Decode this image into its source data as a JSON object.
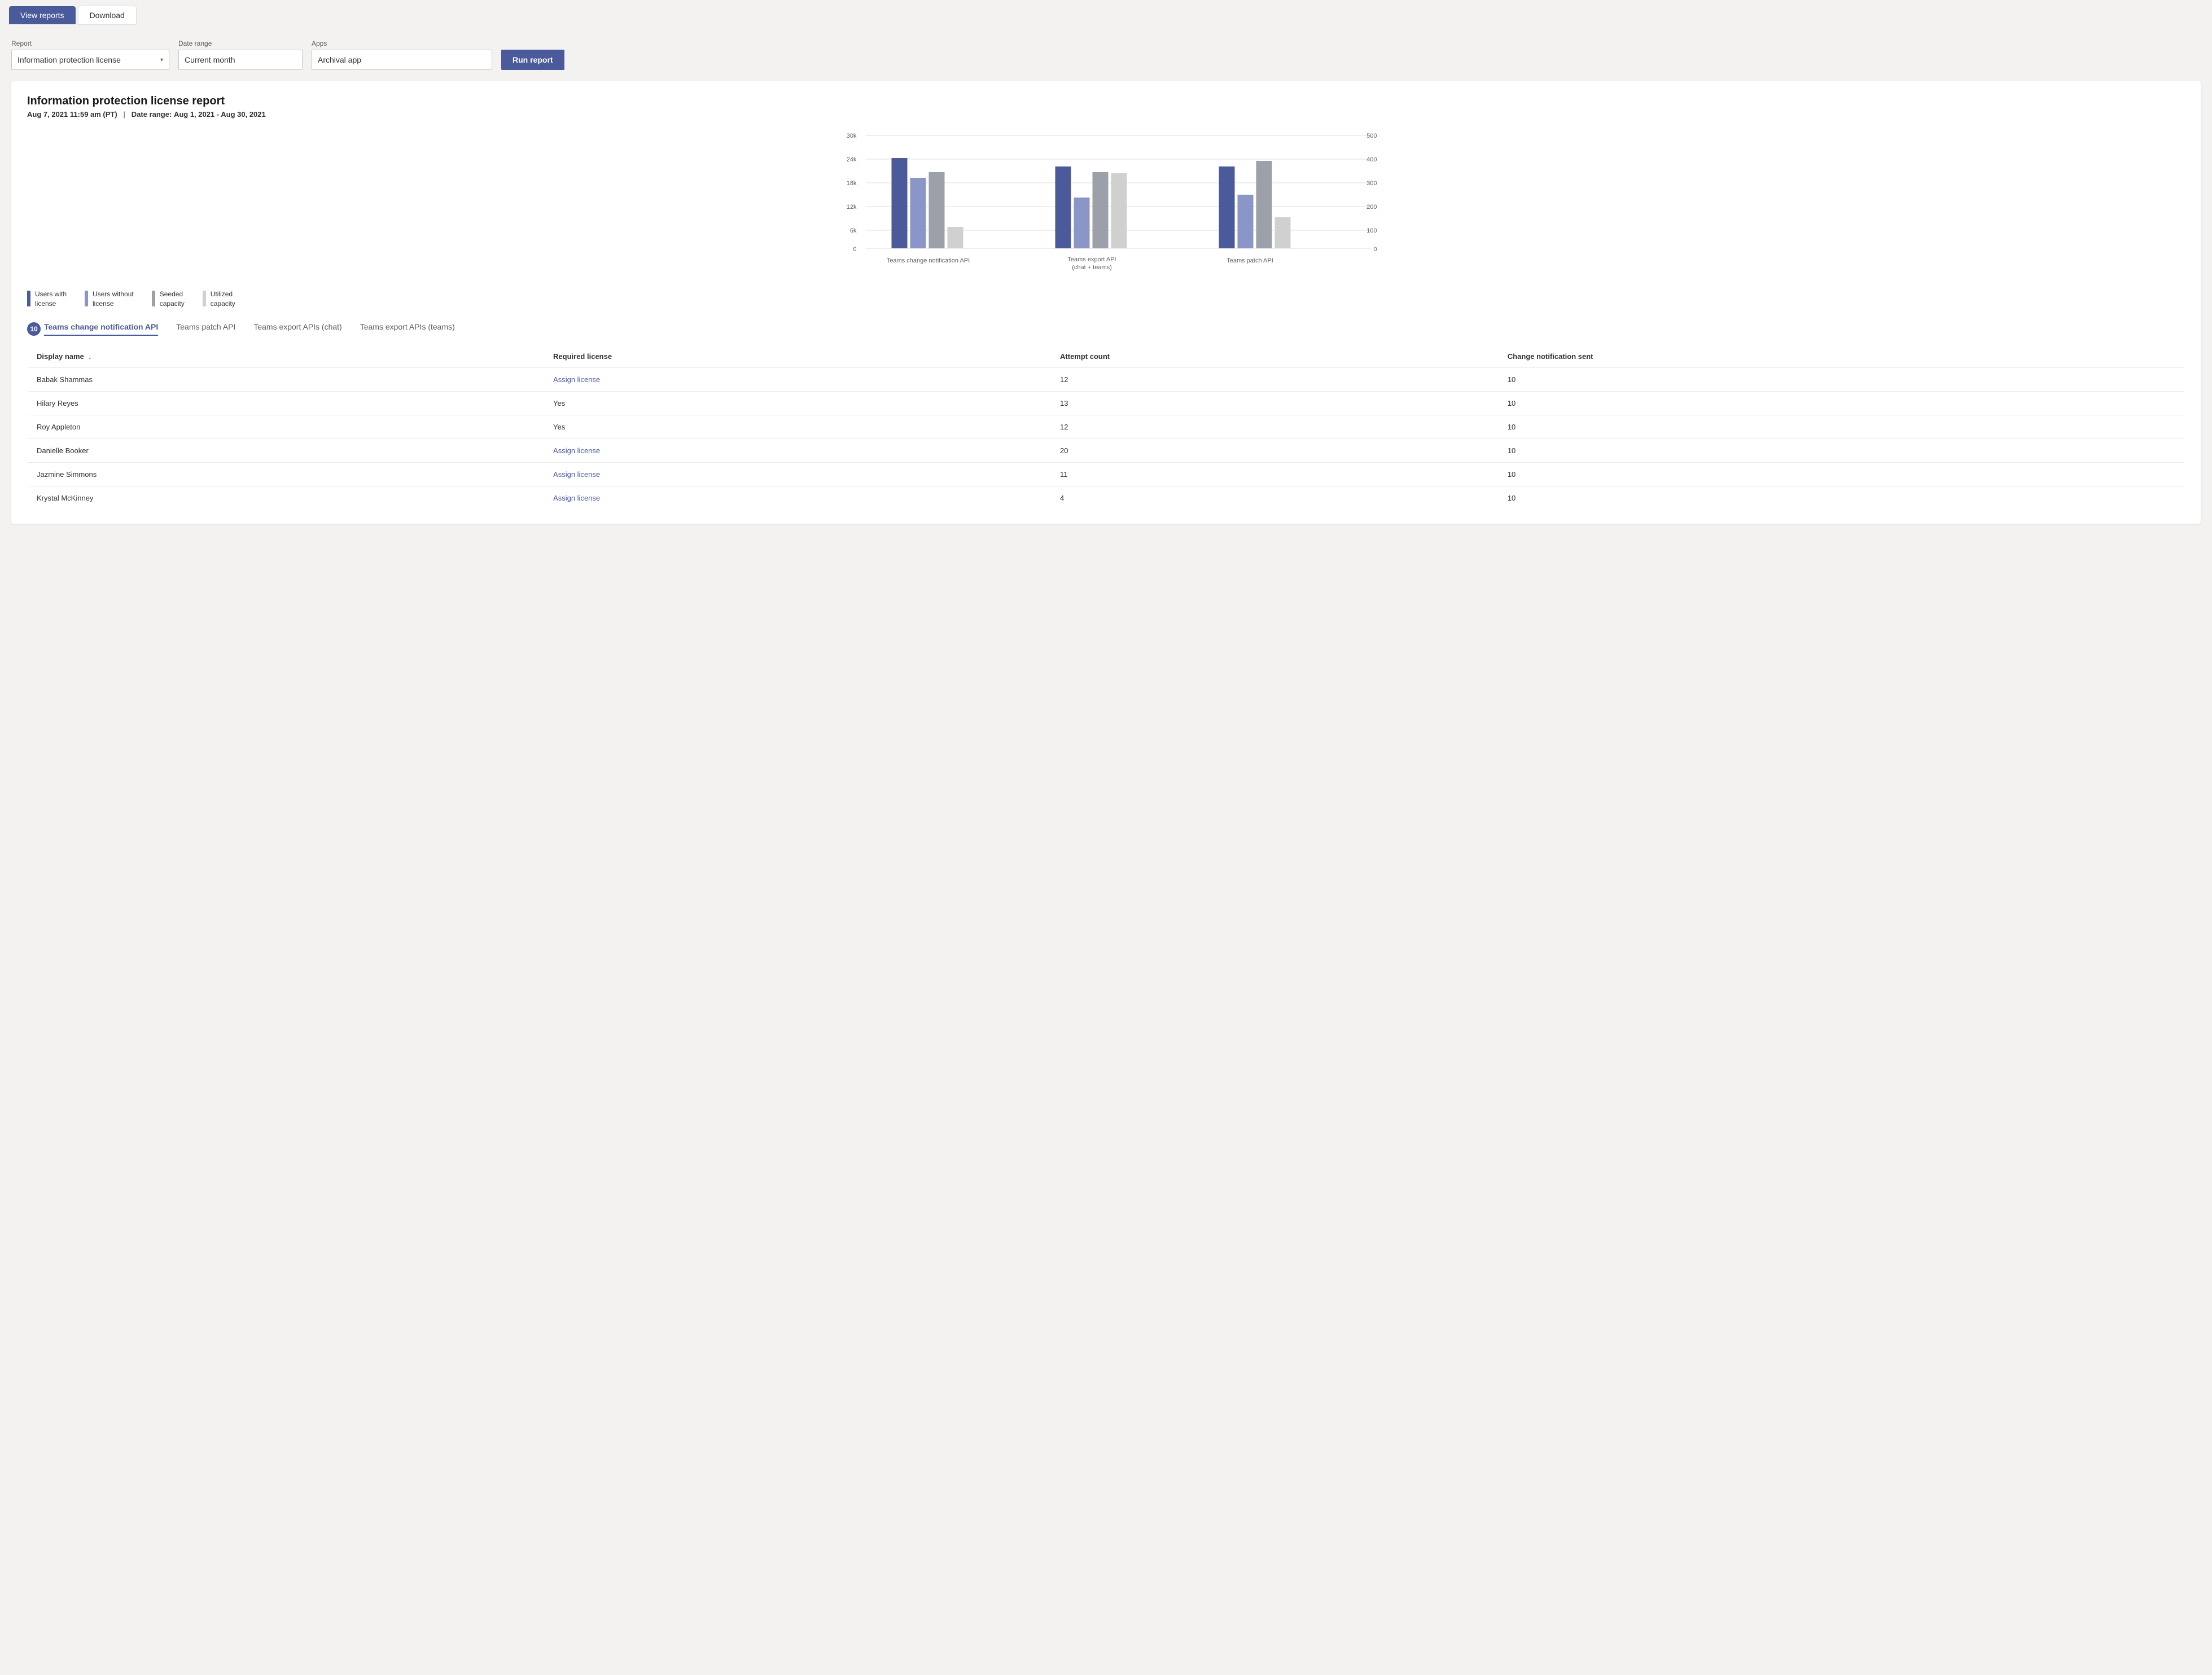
{
  "toolbar": {
    "tab_view_reports": "View reports",
    "tab_download": "Download"
  },
  "filters": {
    "report_label": "Report",
    "report_value": "Information protection license",
    "date_range_label": "Date range",
    "date_range_value": "Current month",
    "apps_label": "Apps",
    "apps_value": "Archival app",
    "run_report_label": "Run report"
  },
  "report": {
    "title": "Information protection license report",
    "date_generated": "Aug 7, 2021",
    "time_generated": "11:59 am (PT)",
    "date_range_label": "Date range:",
    "date_range_value": "Aug 1, 2021 - Aug 30, 2021",
    "chart": {
      "y_left_labels": [
        "30k",
        "24k",
        "18k",
        "12k",
        "6k",
        "0"
      ],
      "y_right_labels": [
        "500",
        "400",
        "300",
        "200",
        "100",
        "0"
      ],
      "groups": [
        {
          "label": "Teams change notification API",
          "bars": [
            {
              "type": "users_with_license",
              "value": 85
            },
            {
              "type": "users_without_license",
              "value": 65
            },
            {
              "type": "seeded_capacity",
              "value": 70
            },
            {
              "type": "utilized_capacity",
              "value": 20
            }
          ]
        },
        {
          "label": "Teams export API\n(chat + teams)",
          "bars": [
            {
              "type": "users_with_license",
              "value": 72
            },
            {
              "type": "users_without_license",
              "value": 42
            },
            {
              "type": "seeded_capacity",
              "value": 68
            },
            {
              "type": "utilized_capacity",
              "value": 66
            }
          ]
        },
        {
          "label": "Teams patch API",
          "bars": [
            {
              "type": "users_with_license",
              "value": 72
            },
            {
              "type": "users_without_license",
              "value": 45
            },
            {
              "type": "seeded_capacity",
              "value": 80
            },
            {
              "type": "utilized_capacity",
              "value": 28
            }
          ]
        }
      ]
    },
    "legend": [
      {
        "color": "#4b5a9b",
        "label": "Users with\nlicense"
      },
      {
        "color": "#8b96c8",
        "label": "Users without\nlicense"
      },
      {
        "color": "#9ca0a8",
        "label": "Seeded\ncapacity"
      },
      {
        "color": "#d0d0d0",
        "label": "Utilized\ncapacity"
      }
    ]
  },
  "table_tabs": [
    {
      "id": "teams-change",
      "label": "Teams change notification API",
      "badge": "10",
      "active": true
    },
    {
      "id": "teams-patch",
      "label": "Teams patch API",
      "active": false
    },
    {
      "id": "teams-export-chat",
      "label": "Teams export APIs (chat)",
      "active": false
    },
    {
      "id": "teams-export-teams",
      "label": "Teams export APIs (teams)",
      "active": false
    }
  ],
  "table": {
    "columns": [
      {
        "id": "display_name",
        "label": "Display name",
        "sort": "↓"
      },
      {
        "id": "required_license",
        "label": "Required license"
      },
      {
        "id": "attempt_count",
        "label": "Attempt count"
      },
      {
        "id": "notification_sent",
        "label": "Change notification sent"
      }
    ],
    "rows": [
      {
        "display_name": "Babak Shammas",
        "required_license": "Assign license",
        "required_license_type": "link",
        "attempt_count": "12",
        "notification_sent": "10"
      },
      {
        "display_name": "Hilary Reyes",
        "required_license": "Yes",
        "required_license_type": "text",
        "attempt_count": "13",
        "notification_sent": "10"
      },
      {
        "display_name": "Roy Appleton",
        "required_license": "Yes",
        "required_license_type": "text",
        "attempt_count": "12",
        "notification_sent": "10"
      },
      {
        "display_name": "Danielle Booker",
        "required_license": "Assign license",
        "required_license_type": "link",
        "attempt_count": "20",
        "notification_sent": "10"
      },
      {
        "display_name": "Jazmine Simmons",
        "required_license": "Assign license",
        "required_license_type": "link",
        "attempt_count": "11",
        "notification_sent": "10"
      },
      {
        "display_name": "Krystal McKinney",
        "required_license": "Assign license",
        "required_license_type": "link",
        "attempt_count": "4",
        "notification_sent": "10"
      }
    ]
  }
}
